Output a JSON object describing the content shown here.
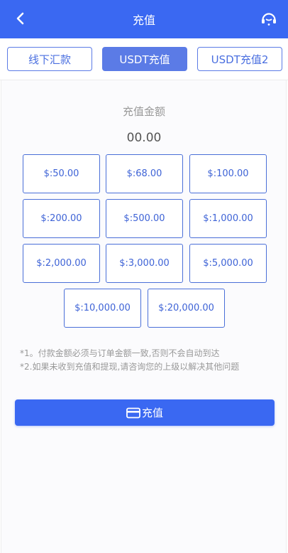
{
  "header": {
    "title": "充值",
    "back_icon": "chevron-left-icon",
    "service_icon": "headset-icon"
  },
  "tabs": [
    {
      "label": "线下汇款",
      "active": false
    },
    {
      "label": "USDT充值",
      "active": true
    },
    {
      "label": "USDT充值2",
      "active": false
    }
  ],
  "recharge": {
    "amount_label": "充值金额",
    "amount_value": "00.00",
    "options": [
      "$:50.00",
      "$:68.00",
      "$:100.00",
      "$:200.00",
      "$:500.00",
      "$:1,000.00",
      "$:2,000.00",
      "$:3,000.00",
      "$:5,000.00",
      "$:10,000.00",
      "$:20,000.00"
    ]
  },
  "notes": [
    "*1。付款金额必须与订单金额一致,否则不会自动到达",
    "*2.如果未收到充值和提现,请咨询您的上级以解决其他问题"
  ],
  "submit": {
    "label": "充值",
    "icon": "card-icon"
  },
  "colors": {
    "primary": "#3a68f2",
    "tab_active": "#5b7be6",
    "amount_border": "#4a6fd8"
  }
}
